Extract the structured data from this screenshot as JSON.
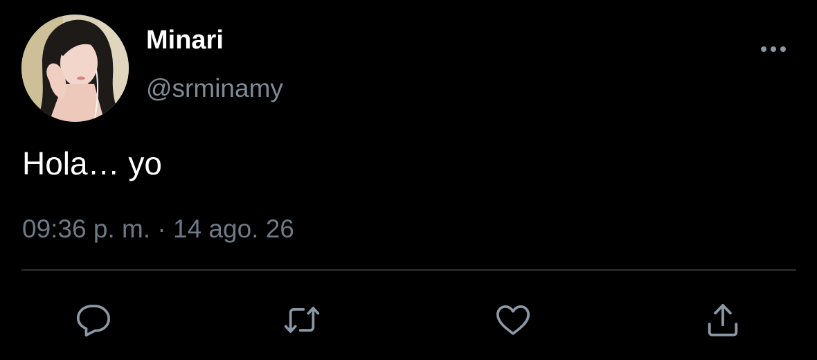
{
  "author": {
    "display_name": "Minari",
    "handle": "@srminamy",
    "avatar": "profile-photo"
  },
  "tweet": {
    "text": "Hola… yo",
    "time": "09:36 p. m.",
    "separator": "·",
    "date": "14 ago. 26"
  },
  "actions": [
    {
      "icon": "reply-icon"
    },
    {
      "icon": "retweet-icon"
    },
    {
      "icon": "like-icon"
    },
    {
      "icon": "share-icon"
    }
  ],
  "menu": {
    "icon": "more-options-icon"
  },
  "colors": {
    "background": "#000000",
    "primary_text": "#ffffff",
    "secondary_text": "#7e8b97",
    "icon": "#8b98a5",
    "divider": "#2f3336"
  }
}
